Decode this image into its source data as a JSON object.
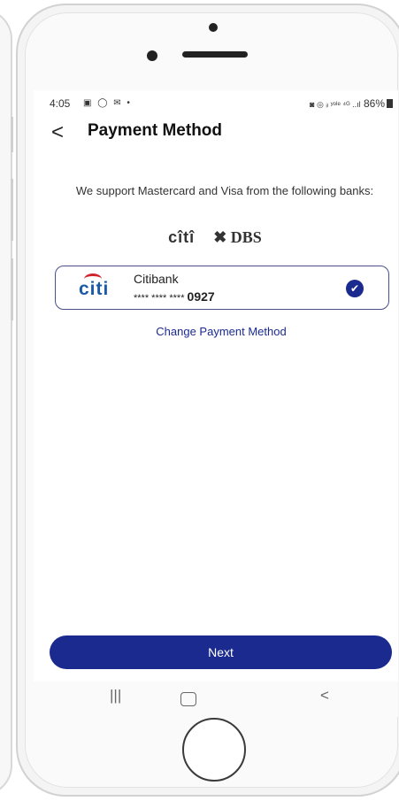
{
  "status_bar": {
    "time": "4:05",
    "left_icons": "▣ ◯ ✉ •",
    "right_icons": "◙ ◎ ᵢₗ ʸᵒˡᵉ ⁴ᴳ ..ıl",
    "battery": "86%"
  },
  "header": {
    "back_label": "<",
    "title": "Payment Method"
  },
  "support_text": "We support Mastercard and Visa from the following banks:",
  "bank_logos": {
    "citi": "cîtî",
    "dbs": "✖ DBS"
  },
  "card": {
    "logo": "citi",
    "bank_name": "Citibank",
    "masked": "**** **** ****",
    "last4": "0927",
    "selected": true
  },
  "change_link": "Change Payment Method",
  "next_button": "Next",
  "nav_bar": {
    "recents": "|||",
    "back": "<"
  },
  "colors": {
    "accent": "#1b2a8f",
    "citi_blue": "#1b5aa6",
    "citi_red": "#d1232a"
  }
}
